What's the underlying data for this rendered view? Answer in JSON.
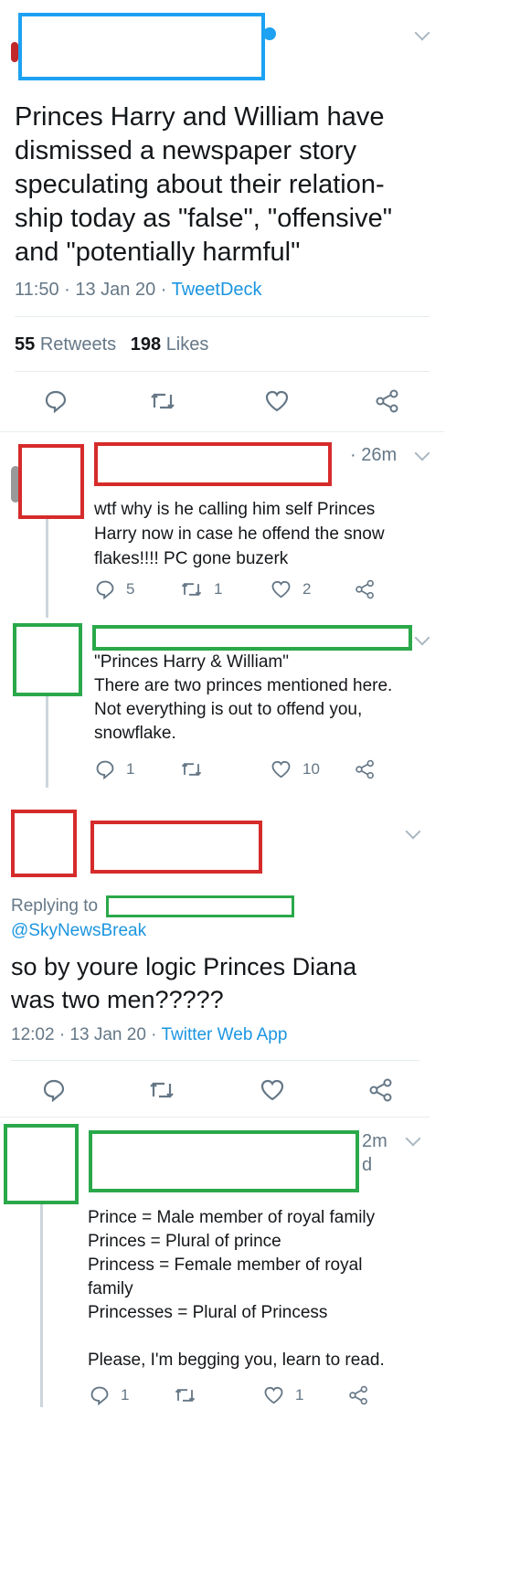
{
  "main_tweet": {
    "text_lines": [
      "Princes Harry and William have",
      "dismissed a newspaper story",
      "speculating about their relation-",
      "ship today as \"false\", \"offensive\"",
      "and \"potentially harmful\""
    ],
    "time_date": "11:50 · 13 Jan 20 · ",
    "client": "TweetDeck",
    "retweets_count": "55",
    "retweets_label": "Retweets",
    "likes_count": "198",
    "likes_label": "Likes"
  },
  "reply1": {
    "time": "· 26m",
    "text_lines": [
      "wtf why is he calling him self Princes",
      "Harry now in case he offend the snow",
      "flakes!!!! PC gone buzerk"
    ],
    "replies": "5",
    "retweets": "1",
    "likes": "2"
  },
  "reply2": {
    "text_lines": [
      "\"Princes Harry & William\"",
      "There are two princes mentioned here.",
      "Not everything is out to offend you,",
      "snowflake."
    ],
    "replies": "1",
    "retweets": "",
    "likes": "10"
  },
  "tweet3": {
    "replying_label": "Replying to",
    "mention": "@SkyNewsBreak",
    "text_lines": [
      "so by youre logic Princes Diana",
      "was two men?????"
    ],
    "time_date": "12:02 · 13 Jan 20 · ",
    "client": "Twitter Web App"
  },
  "reply4": {
    "time_fragment_1": "2m",
    "time_fragment_2": "d",
    "text_lines": [
      "Prince = Male member of royal family",
      "Princes = Plural of prince",
      "Princess = Female member of royal",
      "family",
      "Princesses = Plural of Princess",
      "",
      "Please, I'm begging you, learn to read."
    ],
    "replies": "1",
    "retweets": "",
    "likes": "1"
  },
  "colors": {
    "text": "#14171a",
    "muted": "#657786",
    "link": "#1b95e0",
    "redaction_blue": "#1da1f2",
    "redaction_red": "#d62b2b",
    "redaction_green": "#2aa84a"
  },
  "icons": [
    "chevron-down-icon",
    "reply-icon",
    "retweet-icon",
    "like-icon",
    "share-icon",
    "verified-badge-icon"
  ]
}
